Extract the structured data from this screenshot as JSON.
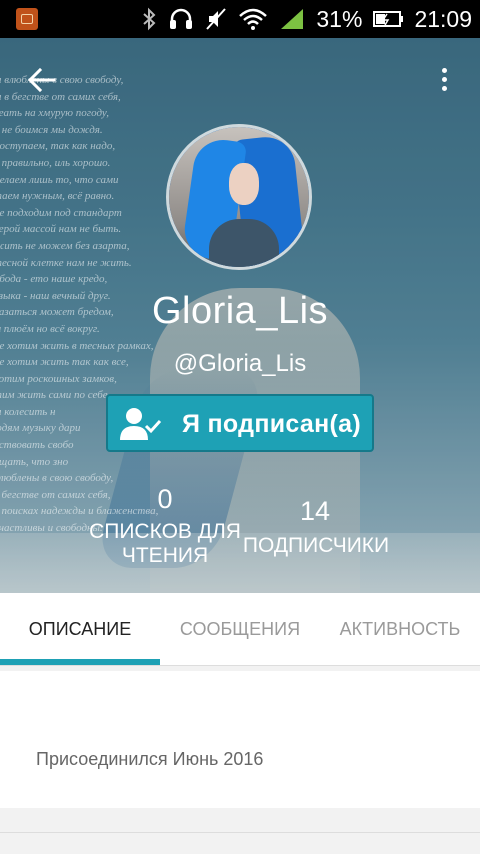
{
  "status_bar": {
    "battery_percent": "31%",
    "time": "21:09",
    "icons": [
      "bluetooth-icon",
      "headphones-icon",
      "mute-icon",
      "wifi-icon",
      "signal-icon",
      "battery-icon"
    ]
  },
  "header": {
    "background_poem_lines": [
      "ы влюблены в свою свободу,",
      "ы в бегстве от самих себя,",
      "веать на хмурую погоду,",
      "ь не боимся мы дождя.",
      "поступаем, так как надо,",
      "х правильно, иль хорошо.",
      "делаем лишь то, что сами",
      "таем нужным, всё равно.",
      "не подходим под стандарт",
      "серой массой нам не быть.",
      "жить не можем без азарта,",
      "тесной клетке нам не жить.",
      "обода - ето наше кредо,",
      "узыка - наш вечный друг.",
      "казаться может бредом,",
      "м плюём но всё вокруг.",
      "не хотим жить в тесных рамках,",
      "не хотим жить так как все,",
      "хотим роскошных замков,",
      "тим жить сами по себе.",
      "ы колесить н",
      "юдям музыку дари",
      "уствовать свобо",
      "ущать, что зно",
      "влюблены в свою свободу,",
      "в бегстве от самих себя,",
      "в поисках надежды и блаженства,",
      "счастливы и свободны."
    ]
  },
  "profile": {
    "display_name": "Gloria_Lis",
    "username": "@Gloria_Lis",
    "follow_button_label": "Я подписан(а)",
    "stats": {
      "reading_lists_count": "0",
      "reading_lists_label_line1": "СПИСКОВ ДЛЯ",
      "reading_lists_label_line2": "ЧТЕНИЯ",
      "followers_count": "14",
      "followers_label": "ПОДПИСЧИКИ"
    }
  },
  "tabs": [
    {
      "label": "ОПИСАНИЕ",
      "active": true
    },
    {
      "label": "СООБЩЕНИЯ",
      "active": false
    },
    {
      "label": "АКТИВНОСТЬ",
      "active": false
    }
  ],
  "description": {
    "joined_text": "Присоединился Июнь 2016"
  },
  "colors": {
    "accent": "#1ea1b5",
    "status_bar": "#000000",
    "signal_green": "#7cc142"
  }
}
